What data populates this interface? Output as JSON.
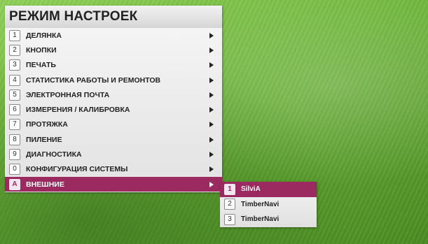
{
  "screen": {
    "title": "РЕЖИМ НАСТРОЕК",
    "accent_color": "#9b2a60"
  },
  "menu": {
    "items": [
      {
        "key": "1",
        "label": "ДЕЛЯНКА"
      },
      {
        "key": "2",
        "label": "КНОПКИ"
      },
      {
        "key": "3",
        "label": "ПЕЧАТЬ"
      },
      {
        "key": "4",
        "label": "СТАТИСТИКА РАБОТЫ И РЕМОНТОВ"
      },
      {
        "key": "5",
        "label": "ЭЛЕКТРОННАЯ ПОЧТА"
      },
      {
        "key": "6",
        "label": "ИЗМЕРЕНИЯ / КАЛИБРОВКА"
      },
      {
        "key": "7",
        "label": "ПРОТЯЖКА"
      },
      {
        "key": "8",
        "label": "ПИЛЕНИЕ"
      },
      {
        "key": "9",
        "label": "ДИАГНОСТИКА"
      },
      {
        "key": "0",
        "label": "КОНФИГУРАЦИЯ СИСТЕМЫ"
      },
      {
        "key": "A",
        "label": "ВНЕШНИЕ",
        "selected": true
      }
    ]
  },
  "submenu": {
    "items": [
      {
        "key": "1",
        "label": "SilviA",
        "selected": true
      },
      {
        "key": "2",
        "label": "TimberNavi"
      },
      {
        "key": "3",
        "label": "TimberNavi"
      }
    ]
  }
}
